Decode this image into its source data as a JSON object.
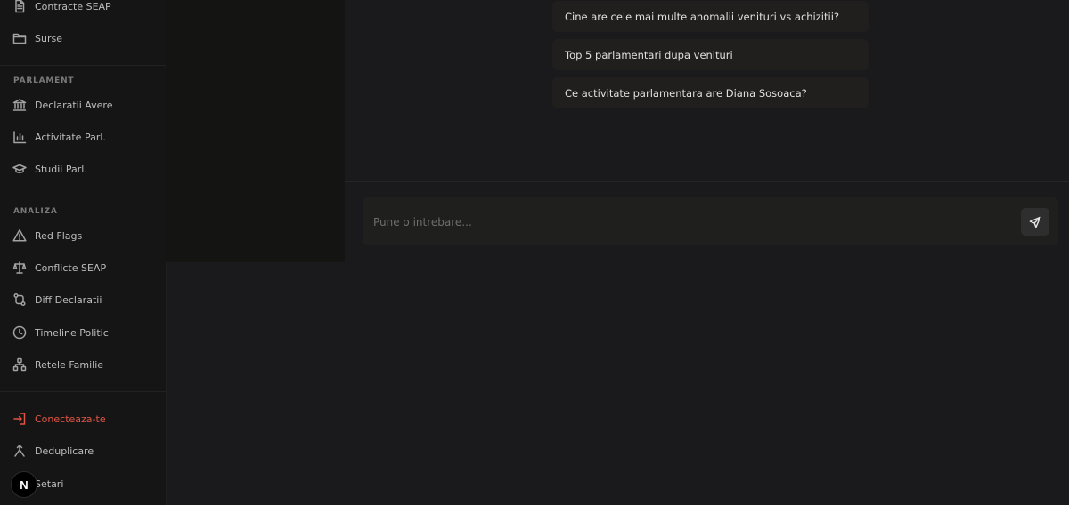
{
  "sidebar": {
    "top_items": [
      {
        "label": "Contracte SEAP",
        "icon": "file-text-icon"
      },
      {
        "label": "Surse",
        "icon": "folder-icon"
      }
    ],
    "sections": [
      {
        "title": "PARLAMENT",
        "items": [
          {
            "label": "Declaratii Avere",
            "icon": "landmark-icon"
          },
          {
            "label": "Activitate Parl.",
            "icon": "bar-chart-icon"
          },
          {
            "label": "Studii Parl.",
            "icon": "graduation-cap-icon"
          }
        ]
      },
      {
        "title": "ANALIZA",
        "items": [
          {
            "label": "Red Flags",
            "icon": "alert-triangle-icon"
          },
          {
            "label": "Conflicte SEAP",
            "icon": "scale-icon"
          },
          {
            "label": "Diff Declaratii",
            "icon": "git-compare-icon"
          },
          {
            "label": "Timeline Politic",
            "icon": "clock-icon"
          },
          {
            "label": "Retele Familie",
            "icon": "network-icon"
          }
        ]
      }
    ],
    "bottom_items": [
      {
        "label": "Conecteaza-te",
        "icon": "log-in-icon",
        "active": true,
        "color": "#e05545"
      },
      {
        "label": "Deduplicare",
        "icon": "merge-icon"
      },
      {
        "label": "Setari",
        "icon": "settings-icon"
      }
    ],
    "badge": "N"
  },
  "suggestions": [
    "Cine are cele mai multe anomalii venituri vs achizitii?",
    "Top 5 parlamentari dupa venituri",
    "Ce activitate parlamentara are Diana Sosoaca?"
  ],
  "composer": {
    "placeholder": "Pune o intrebare...",
    "send_icon": "send-icon"
  }
}
